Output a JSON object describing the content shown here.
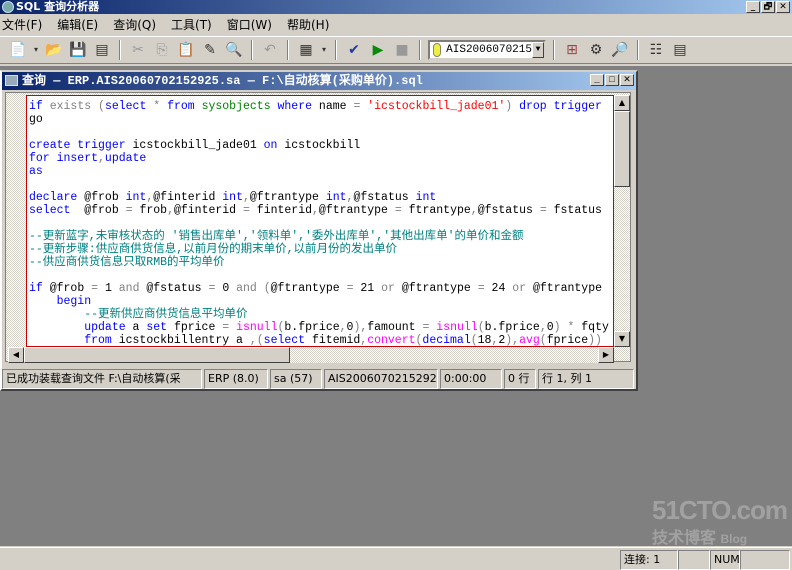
{
  "app": {
    "title": "SQL 查询分析器",
    "window_buttons": [
      "_",
      "🗗",
      "✕"
    ]
  },
  "menu": [
    "文件(F)",
    "编辑(E)",
    "查询(Q)",
    "工具(T)",
    "窗口(W)",
    "帮助(H)"
  ],
  "toolbar": {
    "icons": [
      "new-query-icon",
      "open-icon",
      "save-icon",
      "insert-template-icon",
      "cut-icon",
      "copy-icon",
      "paste-icon",
      "clear-icon",
      "find-icon",
      "undo-icon",
      "results-grid-icon",
      "check-syntax-icon",
      "execute-icon",
      "stop-icon"
    ],
    "database": "AIS2006070215",
    "icons_right": [
      "object-browser-icon",
      "object-search-icon",
      "estimated-plan-icon",
      "properties-icon",
      "table-icon"
    ]
  },
  "child": {
    "title": "查询 — ERP.AIS20060702152925.sa — F:\\自动核算(采购单价).sql",
    "window_buttons": [
      "_",
      "□",
      "✕"
    ]
  },
  "code": [
    [
      [
        "if ",
        "kw"
      ],
      [
        "exists ",
        "gr"
      ],
      [
        "(",
        "gr"
      ],
      [
        "select ",
        "kw"
      ],
      [
        "* ",
        "gr"
      ],
      [
        "from ",
        "kw"
      ],
      [
        "sysobjects ",
        "sy"
      ],
      [
        "where ",
        "kw"
      ],
      [
        "name ",
        "tx"
      ],
      [
        "= ",
        "gr"
      ],
      [
        "'icstockbill_jade01'",
        "st"
      ],
      [
        ") ",
        "gr"
      ],
      [
        "drop trigger",
        "kw"
      ]
    ],
    [
      [
        "go",
        "tx"
      ]
    ],
    [],
    [
      [
        "create trigger ",
        "kw"
      ],
      [
        "icstockbill_jade01 ",
        "tx"
      ],
      [
        "on ",
        "kw"
      ],
      [
        "icstockbill",
        "tx"
      ]
    ],
    [
      [
        "for insert",
        "kw"
      ],
      [
        ",",
        "gr"
      ],
      [
        "update",
        "kw"
      ]
    ],
    [
      [
        "as",
        "kw"
      ]
    ],
    [],
    [
      [
        "declare ",
        "kw"
      ],
      [
        "@frob ",
        "tx"
      ],
      [
        "int",
        "kw"
      ],
      [
        ",",
        "gr"
      ],
      [
        "@finterid ",
        "tx"
      ],
      [
        "int",
        "kw"
      ],
      [
        ",",
        "gr"
      ],
      [
        "@ftrantype ",
        "tx"
      ],
      [
        "int",
        "kw"
      ],
      [
        ",",
        "gr"
      ],
      [
        "@fstatus ",
        "tx"
      ],
      [
        "int",
        "kw"
      ]
    ],
    [
      [
        "select  ",
        "kw"
      ],
      [
        "@frob ",
        "tx"
      ],
      [
        "= ",
        "gr"
      ],
      [
        "frob",
        "tx"
      ],
      [
        ",",
        "gr"
      ],
      [
        "@finterid ",
        "tx"
      ],
      [
        "= ",
        "gr"
      ],
      [
        "finterid",
        "tx"
      ],
      [
        ",",
        "gr"
      ],
      [
        "@ftrantype ",
        "tx"
      ],
      [
        "= ",
        "gr"
      ],
      [
        "ftrantype",
        "tx"
      ],
      [
        ",",
        "gr"
      ],
      [
        "@fstatus ",
        "tx"
      ],
      [
        "= ",
        "gr"
      ],
      [
        "fstatus",
        "tx"
      ]
    ],
    [],
    [
      [
        "--更新蓝字,未审核状态的 '销售出库单','领料单','委外出库单','其他出库单'的单价和金额",
        "cm"
      ]
    ],
    [
      [
        "--更新步骤:供应商供货信息,以前月份的期末单价,以前月份的发出单价",
        "cm"
      ]
    ],
    [
      [
        "--供应商供货信息只取RMB的平均单价",
        "cm"
      ]
    ],
    [],
    [
      [
        "if ",
        "kw"
      ],
      [
        "@frob ",
        "tx"
      ],
      [
        "= ",
        "gr"
      ],
      [
        "1 ",
        "tx"
      ],
      [
        "and ",
        "gr"
      ],
      [
        "@fstatus ",
        "tx"
      ],
      [
        "= ",
        "gr"
      ],
      [
        "0 ",
        "tx"
      ],
      [
        "and ",
        "gr"
      ],
      [
        "(",
        "gr"
      ],
      [
        "@ftrantype ",
        "tx"
      ],
      [
        "= ",
        "gr"
      ],
      [
        "21 ",
        "tx"
      ],
      [
        "or ",
        "gr"
      ],
      [
        "@ftrantype ",
        "tx"
      ],
      [
        "= ",
        "gr"
      ],
      [
        "24 ",
        "tx"
      ],
      [
        "or ",
        "gr"
      ],
      [
        "@ftrantype",
        "tx"
      ]
    ],
    [
      [
        "    begin",
        "kw"
      ]
    ],
    [
      [
        "        --更新供应商供货信息平均单价",
        "cm"
      ]
    ],
    [
      [
        "        update ",
        "kw"
      ],
      [
        "a ",
        "tx"
      ],
      [
        "set ",
        "kw"
      ],
      [
        "fprice ",
        "tx"
      ],
      [
        "= ",
        "gr"
      ],
      [
        "isnull",
        "fn"
      ],
      [
        "(",
        "gr"
      ],
      [
        "b.fprice",
        "tx"
      ],
      [
        ",",
        "gr"
      ],
      [
        "0",
        "tx"
      ],
      [
        "),",
        "gr"
      ],
      [
        "famount ",
        "tx"
      ],
      [
        "= ",
        "gr"
      ],
      [
        "isnull",
        "fn"
      ],
      [
        "(",
        "gr"
      ],
      [
        "b.fprice",
        "tx"
      ],
      [
        ",",
        "gr"
      ],
      [
        "0",
        "tx"
      ],
      [
        ") ",
        "gr"
      ],
      [
        "* ",
        "gr"
      ],
      [
        "fqty",
        "tx"
      ]
    ],
    [
      [
        "        from ",
        "kw"
      ],
      [
        "icstockbillentry ",
        "tx"
      ],
      [
        "a ",
        "tx"
      ],
      [
        ",(",
        "gr"
      ],
      [
        "select ",
        "kw"
      ],
      [
        "fitemid",
        "tx"
      ],
      [
        ",",
        "gr"
      ],
      [
        "convert",
        "fn"
      ],
      [
        "(",
        "gr"
      ],
      [
        "decimal",
        "kw"
      ],
      [
        "(",
        "gr"
      ],
      [
        "18",
        "tx"
      ],
      [
        ",",
        "gr"
      ],
      [
        "2",
        "tx"
      ],
      [
        "),",
        "gr"
      ],
      [
        "avg",
        "fn"
      ],
      [
        "(",
        "gr"
      ],
      [
        "fprice",
        "tx"
      ],
      [
        "))",
        "gr"
      ]
    ]
  ],
  "child_status": [
    "已成功装载查询文件 F:\\自动核算(采",
    "ERP (8.0)",
    "sa (57)",
    "AIS20060702152925",
    "0:00:00",
    "0 行",
    "行 1, 列 1"
  ],
  "app_status": {
    "connections": "连接: 1",
    "num": "NUM"
  },
  "watermark": {
    "line1": "51CTO.com",
    "line2": "技术博客",
    "line3": "Blog"
  }
}
